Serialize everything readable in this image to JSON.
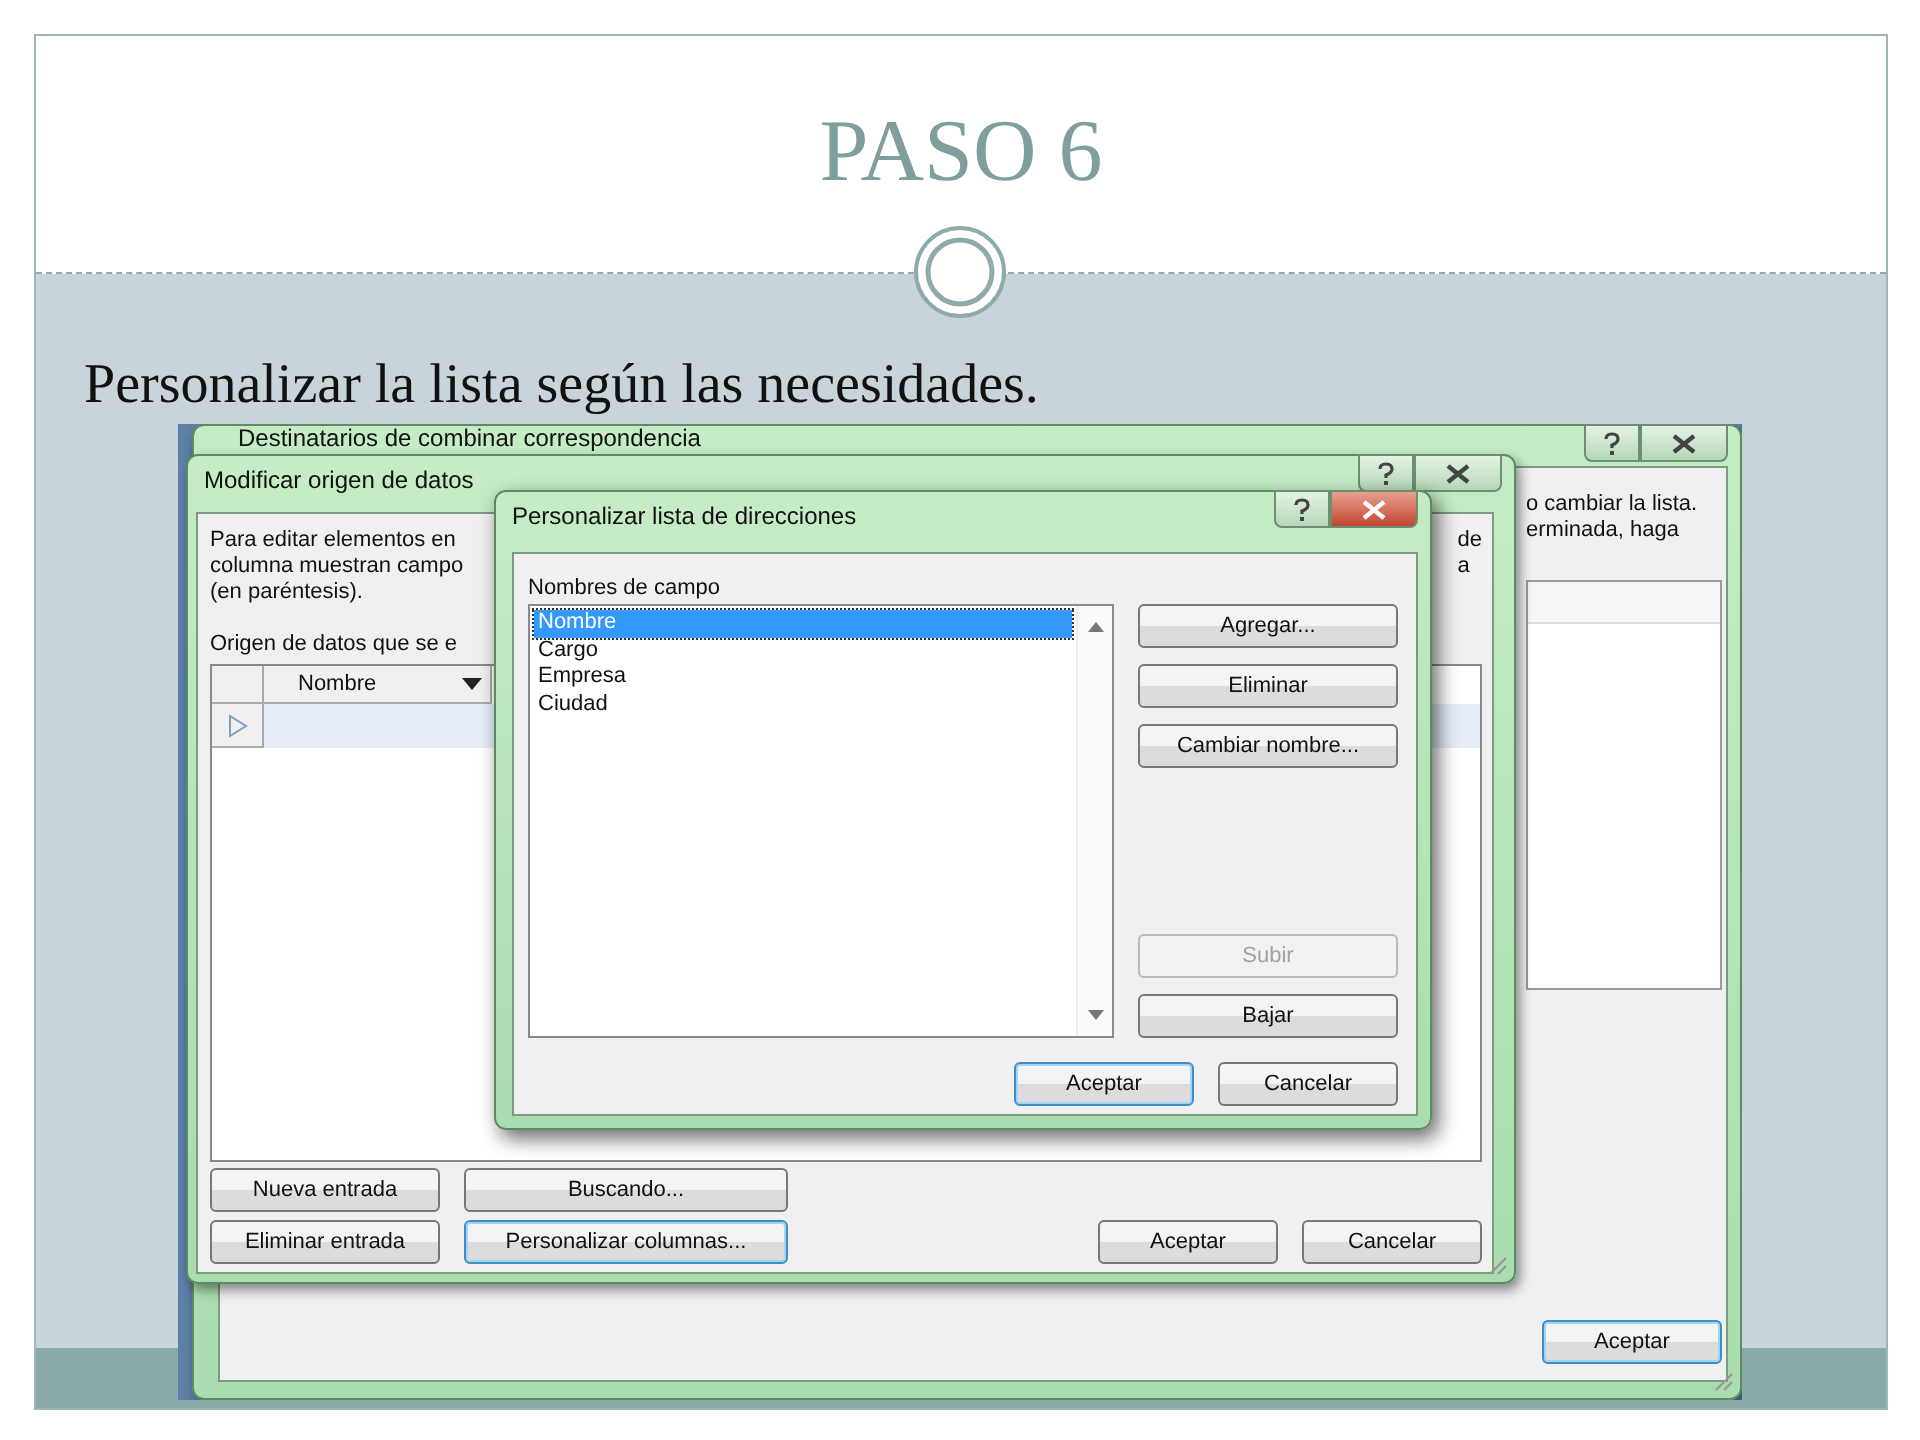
{
  "slide": {
    "title": "PASO 6",
    "subtitle": "Personalizar la lista según las necesidades."
  },
  "back_window": {
    "title": "Destinatarios de combinar correspondencia",
    "text_lines": [
      "o cambiar la lista.",
      "erminada, haga"
    ],
    "buttons": [
      {
        "label": "Aceptar",
        "default": true
      }
    ]
  },
  "data_source_dialog": {
    "title": "Modificar origen de datos",
    "text_lines": [
      "Para editar elementos en",
      "columna muestran campo",
      "(en paréntesis)."
    ],
    "right_fragments": [
      "de",
      "a"
    ],
    "list_label": "Origen de datos que se e",
    "table": {
      "columns": [
        "Nombre"
      ]
    },
    "buttons": [
      {
        "label": "Nueva entrada",
        "default": false
      },
      {
        "label": "Buscando...",
        "default": false
      },
      {
        "label": "Eliminar entrada",
        "default": false
      },
      {
        "label": "Personalizar columnas...",
        "default": true
      }
    ],
    "footer_buttons": [
      {
        "label": "Aceptar",
        "default": false
      },
      {
        "label": "Cancelar",
        "default": false
      }
    ]
  },
  "customize_dialog": {
    "title": "Personalizar lista de direcciones",
    "list_label": "Nombres de campo",
    "fields": [
      {
        "label": "Nombre",
        "selected": true
      },
      {
        "label": "Cargo",
        "selected": false
      },
      {
        "label": "Empresa",
        "selected": false
      },
      {
        "label": "Ciudad",
        "selected": false
      }
    ],
    "side_buttons": [
      {
        "label": "Agregar...",
        "disabled": false
      },
      {
        "label": "Eliminar",
        "disabled": false
      },
      {
        "label": "Cambiar nombre...",
        "disabled": false
      },
      {
        "label": "Subir",
        "disabled": true
      },
      {
        "label": "Bajar",
        "disabled": false
      }
    ],
    "footer_buttons": [
      {
        "label": "Aceptar",
        "default": true
      },
      {
        "label": "Cancelar",
        "default": false
      }
    ]
  }
}
